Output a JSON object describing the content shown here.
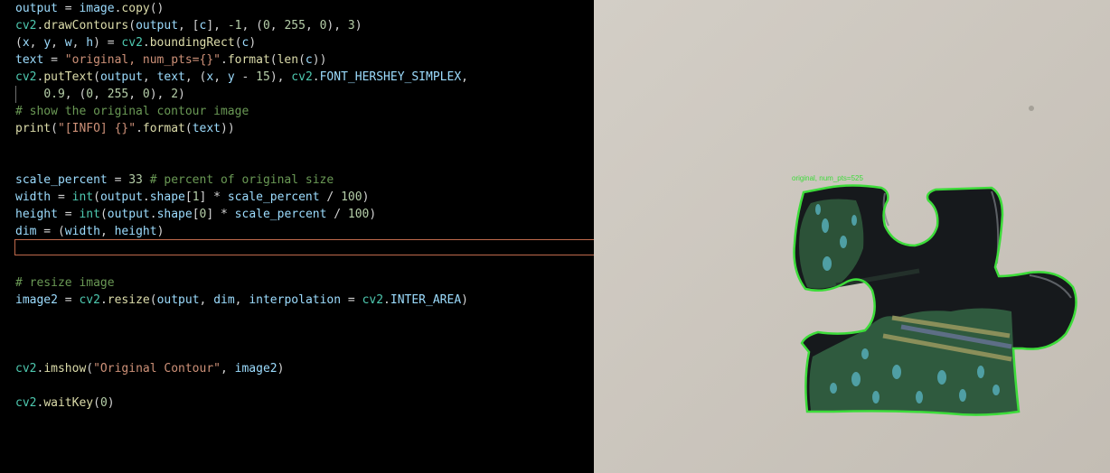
{
  "editor": {
    "lines": [
      {
        "tokens": [
          [
            "output",
            "var"
          ],
          [
            " = ",
            "punc"
          ],
          [
            "image",
            "var"
          ],
          [
            ".",
            "punc"
          ],
          [
            "copy",
            "fn"
          ],
          [
            "()",
            "punc"
          ]
        ]
      },
      {
        "tokens": [
          [
            "cv2",
            "cls"
          ],
          [
            ".",
            "punc"
          ],
          [
            "drawContours",
            "fn"
          ],
          [
            "(",
            "punc"
          ],
          [
            "output",
            "var"
          ],
          [
            ", [",
            "punc"
          ],
          [
            "c",
            "var"
          ],
          [
            "], ",
            "punc"
          ],
          [
            "-1",
            "num"
          ],
          [
            ", (",
            "punc"
          ],
          [
            "0",
            "num"
          ],
          [
            ", ",
            "punc"
          ],
          [
            "255",
            "num"
          ],
          [
            ", ",
            "punc"
          ],
          [
            "0",
            "num"
          ],
          [
            "), ",
            "punc"
          ],
          [
            "3",
            "num"
          ],
          [
            ")",
            "punc"
          ]
        ]
      },
      {
        "tokens": [
          [
            "(",
            "punc"
          ],
          [
            "x",
            "var"
          ],
          [
            ", ",
            "punc"
          ],
          [
            "y",
            "var"
          ],
          [
            ", ",
            "punc"
          ],
          [
            "w",
            "var"
          ],
          [
            ", ",
            "punc"
          ],
          [
            "h",
            "var"
          ],
          [
            ") = ",
            "punc"
          ],
          [
            "cv2",
            "cls"
          ],
          [
            ".",
            "punc"
          ],
          [
            "boundingRect",
            "fn"
          ],
          [
            "(",
            "punc"
          ],
          [
            "c",
            "var"
          ],
          [
            ")",
            "punc"
          ]
        ]
      },
      {
        "tokens": [
          [
            "text",
            "var"
          ],
          [
            " = ",
            "punc"
          ],
          [
            "\"original, num_pts={}\"",
            "str"
          ],
          [
            ".",
            "punc"
          ],
          [
            "format",
            "fn"
          ],
          [
            "(",
            "punc"
          ],
          [
            "len",
            "fn"
          ],
          [
            "(",
            "punc"
          ],
          [
            "c",
            "var"
          ],
          [
            "))",
            "punc"
          ]
        ]
      },
      {
        "tokens": [
          [
            "cv2",
            "cls"
          ],
          [
            ".",
            "punc"
          ],
          [
            "putText",
            "fn"
          ],
          [
            "(",
            "punc"
          ],
          [
            "output",
            "var"
          ],
          [
            ", ",
            "punc"
          ],
          [
            "text",
            "var"
          ],
          [
            ", (",
            "punc"
          ],
          [
            "x",
            "var"
          ],
          [
            ", ",
            "punc"
          ],
          [
            "y",
            "var"
          ],
          [
            " - ",
            "punc"
          ],
          [
            "15",
            "num"
          ],
          [
            "), ",
            "punc"
          ],
          [
            "cv2",
            "cls"
          ],
          [
            ".",
            "punc"
          ],
          [
            "FONT_HERSHEY_SIMPLEX",
            "var"
          ],
          [
            ",",
            "punc"
          ]
        ]
      },
      {
        "tokens": [
          [
            "    ",
            "punc"
          ],
          [
            "0.9",
            "num"
          ],
          [
            ", (",
            "punc"
          ],
          [
            "0",
            "num"
          ],
          [
            ", ",
            "punc"
          ],
          [
            "255",
            "num"
          ],
          [
            ", ",
            "punc"
          ],
          [
            "0",
            "num"
          ],
          [
            "), ",
            "punc"
          ],
          [
            "2",
            "num"
          ],
          [
            ")",
            "punc"
          ]
        ]
      },
      {
        "tokens": [
          [
            "# show the original contour image",
            "com"
          ]
        ]
      },
      {
        "tokens": [
          [
            "print",
            "fn"
          ],
          [
            "(",
            "punc"
          ],
          [
            "\"[INFO] {}\"",
            "str"
          ],
          [
            ".",
            "punc"
          ],
          [
            "format",
            "fn"
          ],
          [
            "(",
            "punc"
          ],
          [
            "text",
            "var"
          ],
          [
            "))",
            "punc"
          ]
        ]
      },
      {
        "tokens": []
      },
      {
        "tokens": []
      },
      {
        "tokens": [
          [
            "scale_percent",
            "var"
          ],
          [
            " = ",
            "punc"
          ],
          [
            "33",
            "num"
          ],
          [
            " ",
            "punc"
          ],
          [
            "# percent of original size",
            "com"
          ]
        ]
      },
      {
        "tokens": [
          [
            "width",
            "var"
          ],
          [
            " = ",
            "punc"
          ],
          [
            "int",
            "cls"
          ],
          [
            "(",
            "punc"
          ],
          [
            "output",
            "var"
          ],
          [
            ".",
            "punc"
          ],
          [
            "shape",
            "var"
          ],
          [
            "[",
            "punc"
          ],
          [
            "1",
            "num"
          ],
          [
            "] * ",
            "punc"
          ],
          [
            "scale_percent",
            "var"
          ],
          [
            " / ",
            "punc"
          ],
          [
            "100",
            "num"
          ],
          [
            ")",
            "punc"
          ]
        ]
      },
      {
        "tokens": [
          [
            "height",
            "var"
          ],
          [
            " = ",
            "punc"
          ],
          [
            "int",
            "cls"
          ],
          [
            "(",
            "punc"
          ],
          [
            "output",
            "var"
          ],
          [
            ".",
            "punc"
          ],
          [
            "shape",
            "var"
          ],
          [
            "[",
            "punc"
          ],
          [
            "0",
            "num"
          ],
          [
            "] * ",
            "punc"
          ],
          [
            "scale_percent",
            "var"
          ],
          [
            " / ",
            "punc"
          ],
          [
            "100",
            "num"
          ],
          [
            ")",
            "punc"
          ]
        ]
      },
      {
        "tokens": [
          [
            "dim",
            "var"
          ],
          [
            " = (",
            "punc"
          ],
          [
            "width",
            "var"
          ],
          [
            ", ",
            "punc"
          ],
          [
            "height",
            "var"
          ],
          [
            ")",
            "punc"
          ]
        ]
      },
      {
        "tokens": []
      },
      {
        "tokens": []
      },
      {
        "tokens": [
          [
            "# resize image",
            "com"
          ]
        ]
      },
      {
        "tokens": [
          [
            "image2",
            "var"
          ],
          [
            " = ",
            "punc"
          ],
          [
            "cv2",
            "cls"
          ],
          [
            ".",
            "punc"
          ],
          [
            "resize",
            "fn"
          ],
          [
            "(",
            "punc"
          ],
          [
            "output",
            "var"
          ],
          [
            ", ",
            "punc"
          ],
          [
            "dim",
            "var"
          ],
          [
            ", ",
            "punc"
          ],
          [
            "interpolation",
            "var"
          ],
          [
            " = ",
            "punc"
          ],
          [
            "cv2",
            "cls"
          ],
          [
            ".",
            "punc"
          ],
          [
            "INTER_AREA",
            "var"
          ],
          [
            ")",
            "punc"
          ]
        ]
      },
      {
        "tokens": []
      },
      {
        "tokens": []
      },
      {
        "tokens": []
      },
      {
        "tokens": [
          [
            "cv2",
            "cls"
          ],
          [
            ".",
            "punc"
          ],
          [
            "imshow",
            "fn"
          ],
          [
            "(",
            "punc"
          ],
          [
            "\"Original Contour\"",
            "str"
          ],
          [
            ", ",
            "punc"
          ],
          [
            "image2",
            "var"
          ],
          [
            ")",
            "punc"
          ]
        ]
      },
      {
        "tokens": []
      },
      {
        "tokens": [
          [
            "cv2",
            "cls"
          ],
          [
            ".",
            "punc"
          ],
          [
            "waitKey",
            "fn"
          ],
          [
            "(",
            "punc"
          ],
          [
            "0",
            "num"
          ],
          [
            ")",
            "punc"
          ]
        ]
      }
    ]
  },
  "viewer": {
    "overlay_label": "original, num_pts=525",
    "contour_color": "#3ddc3a",
    "background_color": "#cdc8c0"
  },
  "colors": {
    "var": "#9cdcfe",
    "fn": "#dcdcaa",
    "cls": "#4ec9b0",
    "str": "#ce9178",
    "num": "#b5cea8",
    "com": "#6a9955",
    "punc": "#d4d4d4"
  }
}
